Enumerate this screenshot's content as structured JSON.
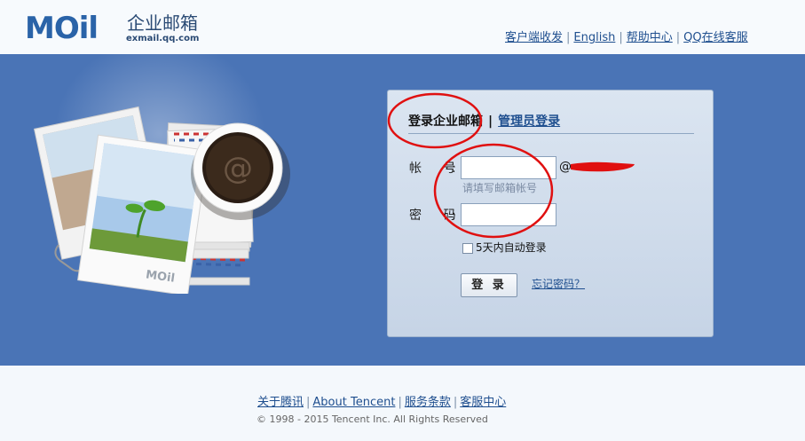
{
  "header": {
    "logo_mark": "MOil",
    "logo_cn": "企业邮箱",
    "logo_domain": "exmail.qq.com",
    "links": [
      "客户端收发",
      "English",
      "帮助中心",
      "QQ在线客服"
    ],
    "link_separator": "|"
  },
  "illustration": {
    "card_logo": "MOil",
    "cup_symbol": "@"
  },
  "login": {
    "tab_active": "登录企业邮箱",
    "tab_separator": "|",
    "tab_admin": "管理员登录",
    "account_label": "帐 号",
    "password_label": "密 码",
    "colon": ":",
    "account_value": "",
    "password_value": "",
    "at_sign": "@",
    "account_hint": "请填写邮箱帐号",
    "remember_label": "5天内自动登录",
    "remember_checked": false,
    "login_button": "登 录",
    "forgot_link": "忘记密码？"
  },
  "footer": {
    "links": [
      "关于腾讯",
      "About Tencent",
      "服务条款",
      "客服中心"
    ],
    "copyright": "© 1998 - 2015 Tencent Inc. All Rights Reserved"
  },
  "colors": {
    "band_blue": "#4a74b6",
    "link_blue": "#1f4f8f",
    "annotation_red": "#e01010"
  }
}
